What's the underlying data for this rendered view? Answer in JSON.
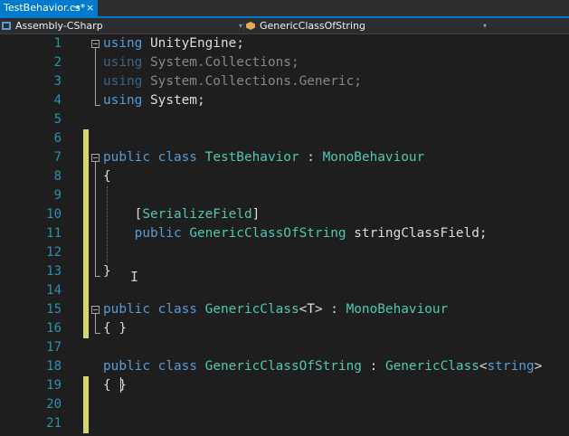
{
  "tab": {
    "label": "TestBehavior.cs*",
    "pin_glyph": "→",
    "close_glyph": "×"
  },
  "nav": {
    "project": "Assembly-CSharp",
    "member": "GenericClassOfString",
    "dropdown_arrow": "▾"
  },
  "editor": {
    "line_numbers": [
      "1",
      "2",
      "3",
      "4",
      "5",
      "6",
      "7",
      "8",
      "9",
      "10",
      "11",
      "12",
      "13",
      "14",
      "15",
      "16",
      "17",
      "18",
      "19",
      "20",
      "21"
    ],
    "lines": {
      "l1": [
        "using",
        " UnityEngine;"
      ],
      "l2": [
        "using",
        " System.Collections;"
      ],
      "l3": [
        "using",
        " System.Collections.Generic;"
      ],
      "l4": [
        "using",
        " System;"
      ],
      "l7": [
        "public",
        " ",
        "class",
        " ",
        "TestBehavior",
        " : ",
        "MonoBehaviour"
      ],
      "l8": [
        "{"
      ],
      "l10": [
        "    [",
        "SerializeField",
        "]"
      ],
      "l11": [
        "    ",
        "public",
        " ",
        "GenericClassOfString",
        " stringClassField;"
      ],
      "l13": [
        "}"
      ],
      "l15": [
        "public",
        " ",
        "class",
        " ",
        "GenericClass",
        "<T> : ",
        "MonoBehaviour"
      ],
      "l16": [
        "{ }"
      ],
      "l18": [
        "public",
        " ",
        "class",
        " ",
        "GenericClassOfString",
        " : ",
        "GenericClass",
        "<",
        "string",
        ">"
      ],
      "l19": [
        "{ }"
      ]
    }
  },
  "colors": {
    "accent": "#007acc",
    "keyword": "#569cd6",
    "type": "#4ec9b0",
    "line_number": "#2b91af",
    "change_bar": "#d7d56f"
  }
}
